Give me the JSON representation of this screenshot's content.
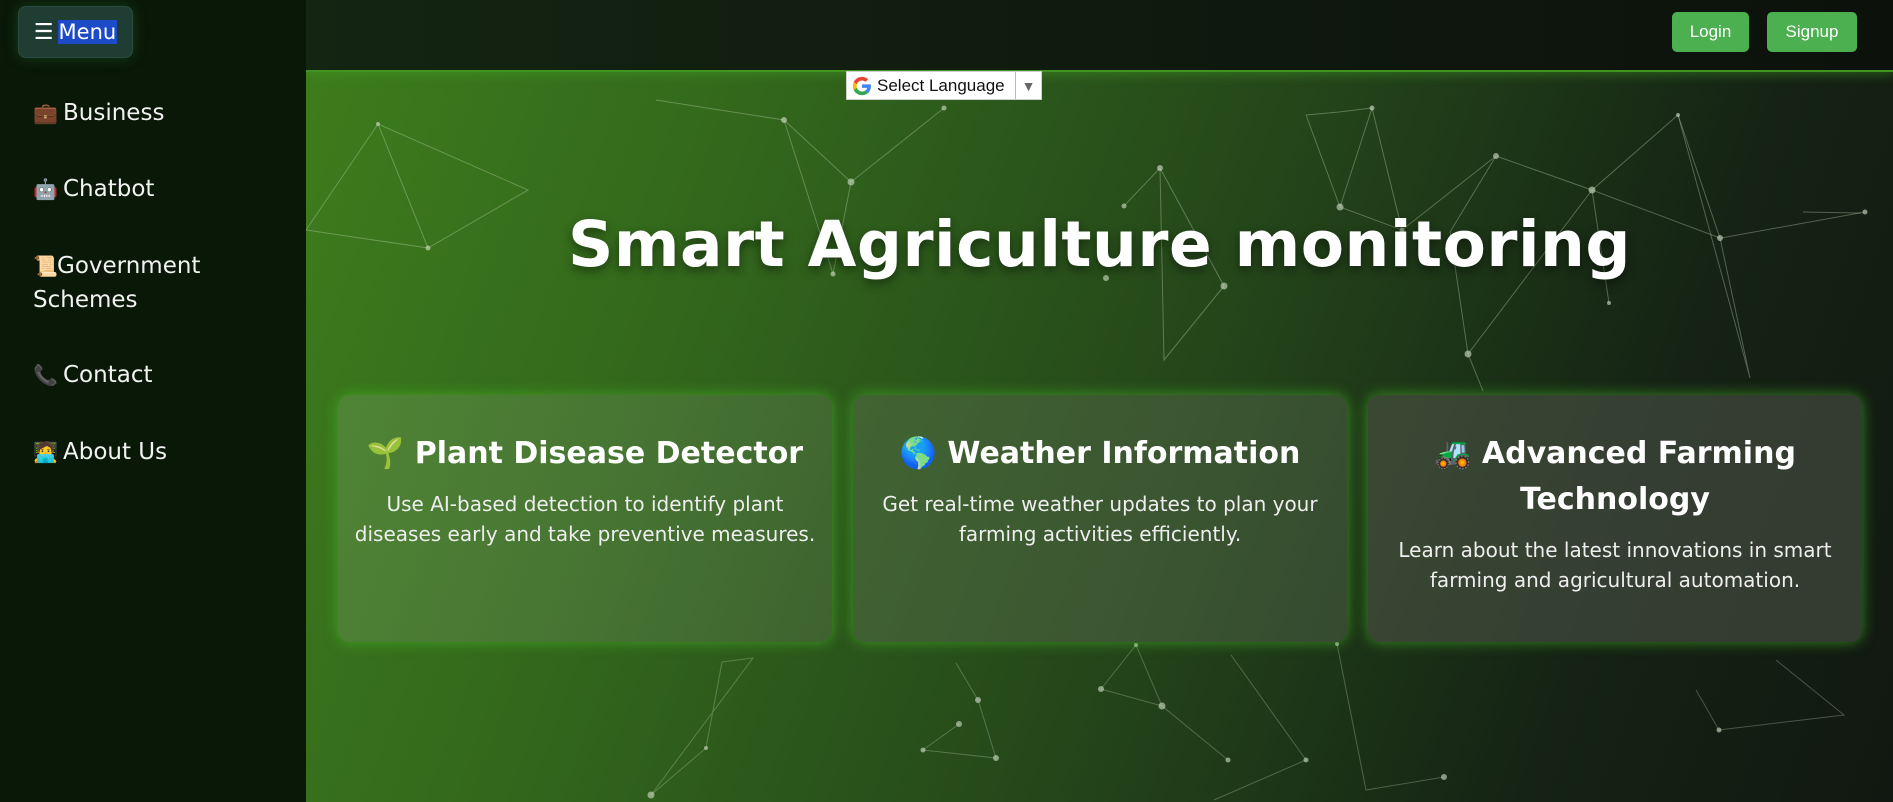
{
  "sidebar": {
    "menu_label": "Menu",
    "items": [
      {
        "icon": "briefcase-icon",
        "emoji": "💼",
        "label": "Business"
      },
      {
        "icon": "robot-icon",
        "emoji": "🤖",
        "label": "Chatbot"
      },
      {
        "icon": "scroll-icon",
        "emoji": "📜",
        "label": "Government Schemes"
      },
      {
        "icon": "phone-icon",
        "emoji": "📞",
        "label": "Contact"
      },
      {
        "icon": "technologist-icon",
        "emoji": "🧑‍💻",
        "label": "About Us"
      }
    ]
  },
  "header": {
    "login_label": "Login",
    "signup_label": "Signup"
  },
  "language": {
    "label": "Select Language",
    "arrow": "▼"
  },
  "hero": {
    "title": "Smart Agriculture monitoring"
  },
  "cards": [
    {
      "icon": "seedling-icon",
      "emoji": "🌱",
      "title": "Plant Disease Detector",
      "text": "Use AI-based detection to identify plant diseases early and take preventive measures."
    },
    {
      "icon": "globe-icon",
      "emoji": "🌎",
      "title": "Weather Information",
      "text": "Get real-time weather updates to plan your farming activities efficiently."
    },
    {
      "icon": "tractor-icon",
      "emoji": "🚜",
      "title": "Advanced Farming Technology",
      "text": "Learn about the latest innovations in smart farming and agricultural automation."
    }
  ],
  "colors": {
    "accent_green": "#4caf50",
    "sidebar_bg": "#091807",
    "menu_highlight": "#1d4ac7"
  }
}
